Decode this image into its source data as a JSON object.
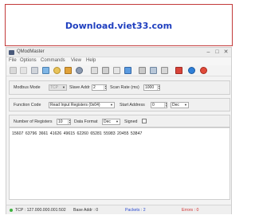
{
  "banner": {
    "text": "Download.viet33.com"
  },
  "window": {
    "title": "QModMaster",
    "controls": {
      "minimize": "–",
      "maximize": "□",
      "close": "✕"
    }
  },
  "menu": [
    "File",
    "Options",
    "Commands",
    "View",
    "Help"
  ],
  "toolbar": {
    "icons": [
      "connect-icon",
      "disconnect-icon",
      "edit-icon",
      "scan-icon",
      "reset-icon",
      "paint-icon",
      "refresh-icon",
      "raw-data-icon",
      "serial-icon",
      "modbus-icon",
      "tcp-icon",
      "settings-icon",
      "log-icon",
      "bus-monitor-icon",
      "tools-icon",
      "info-icon",
      "about-icon"
    ]
  },
  "settings": {
    "mode_label": "Modbus Mode",
    "mode_value": "TCP",
    "slave_label": "Slave Addr",
    "slave_value": "2",
    "scan_label": "Scan Rate (ms)",
    "scan_value": "1000"
  },
  "function": {
    "code_label": "Function Code",
    "code_value": "Read Input Registers (0x04)",
    "start_label": "Start Address",
    "start_value": "0",
    "start_format": "Dec"
  },
  "registers": {
    "count_label": "Number of Registers",
    "count_value": "10",
    "format_label": "Data Format",
    "format_value": "Dec",
    "signed_label": "Signed",
    "signed_checked": false
  },
  "values": "15607 63796 3661 41626 49615 62260 65281 55983 20455 53847",
  "status": {
    "connection": "TCP : 127.000.000.001:502",
    "base_addr": "Base Addr : 0",
    "packets": "Packets : 2",
    "errors": "Errors : 0"
  },
  "colors": {
    "banner_border": "#c23a3a",
    "banner_text": "#1f3fbf",
    "packets_text": "#2a4ad0",
    "errors_text": "#d03030",
    "status_ok": "#3fb23f"
  }
}
